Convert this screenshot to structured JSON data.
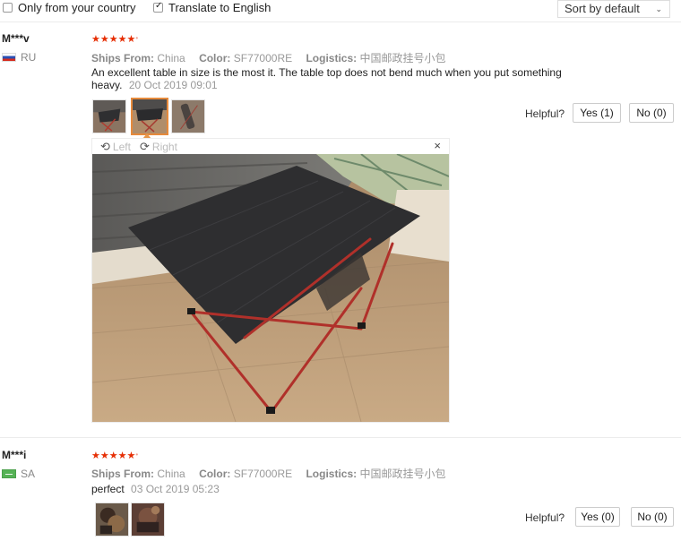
{
  "filters": {
    "country_only": {
      "label": "Only from your country",
      "checked": false
    },
    "translate": {
      "label": "Translate to English",
      "checked": true
    },
    "sort": {
      "value": "Sort by default"
    }
  },
  "labels": {
    "ships_from": "Ships From:",
    "color": "Color:",
    "logistics": "Logistics:",
    "helpful": "Helpful?"
  },
  "viewer": {
    "left_label": "Left",
    "right_label": "Right",
    "close_label": "×"
  },
  "reviews": [
    {
      "user": "M***v",
      "country": "RU",
      "rating": 5,
      "ships_from": "China",
      "color": "SF77000RE",
      "logistics": "中国邮政挂号小包",
      "text": "An excellent table in size is the most it. The table top does not bend much when you put something heavy.",
      "date": "20 Oct 2019 09:01",
      "helpful_yes": "Yes (1)",
      "helpful_no": "No (0)",
      "photos": 3
    },
    {
      "user": "M***i",
      "country": "SA",
      "rating": 5,
      "ships_from": "China",
      "color": "SF77000RE",
      "logistics": "中国邮政挂号小包",
      "text": "perfect",
      "date": "03 Oct 2019 05:23",
      "helpful_yes": "Yes (0)",
      "helpful_no": "No (0)",
      "photos": 2
    }
  ],
  "colors": {
    "star": "#e62e04",
    "accent": "#e68a3c"
  }
}
